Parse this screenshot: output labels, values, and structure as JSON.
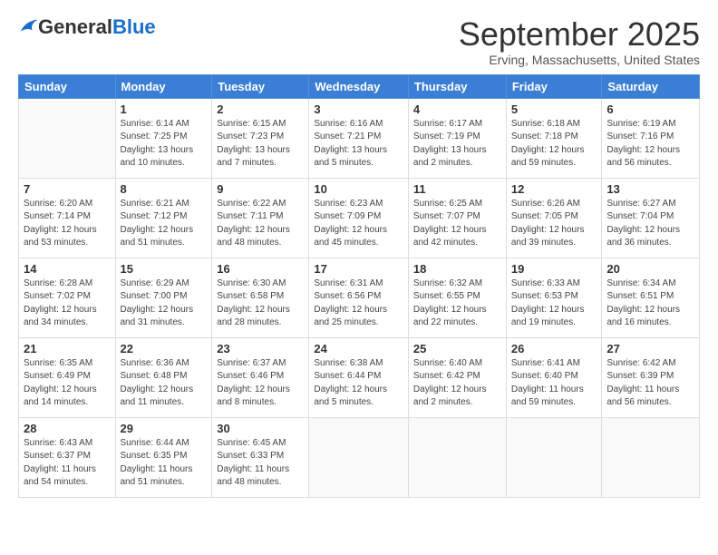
{
  "logo": {
    "general": "General",
    "blue": "Blue"
  },
  "title": "September 2025",
  "location": "Erving, Massachusetts, United States",
  "days_of_week": [
    "Sunday",
    "Monday",
    "Tuesday",
    "Wednesday",
    "Thursday",
    "Friday",
    "Saturday"
  ],
  "weeks": [
    [
      {
        "day": "",
        "info": ""
      },
      {
        "day": "1",
        "info": "Sunrise: 6:14 AM\nSunset: 7:25 PM\nDaylight: 13 hours\nand 10 minutes."
      },
      {
        "day": "2",
        "info": "Sunrise: 6:15 AM\nSunset: 7:23 PM\nDaylight: 13 hours\nand 7 minutes."
      },
      {
        "day": "3",
        "info": "Sunrise: 6:16 AM\nSunset: 7:21 PM\nDaylight: 13 hours\nand 5 minutes."
      },
      {
        "day": "4",
        "info": "Sunrise: 6:17 AM\nSunset: 7:19 PM\nDaylight: 13 hours\nand 2 minutes."
      },
      {
        "day": "5",
        "info": "Sunrise: 6:18 AM\nSunset: 7:18 PM\nDaylight: 12 hours\nand 59 minutes."
      },
      {
        "day": "6",
        "info": "Sunrise: 6:19 AM\nSunset: 7:16 PM\nDaylight: 12 hours\nand 56 minutes."
      }
    ],
    [
      {
        "day": "7",
        "info": "Sunrise: 6:20 AM\nSunset: 7:14 PM\nDaylight: 12 hours\nand 53 minutes."
      },
      {
        "day": "8",
        "info": "Sunrise: 6:21 AM\nSunset: 7:12 PM\nDaylight: 12 hours\nand 51 minutes."
      },
      {
        "day": "9",
        "info": "Sunrise: 6:22 AM\nSunset: 7:11 PM\nDaylight: 12 hours\nand 48 minutes."
      },
      {
        "day": "10",
        "info": "Sunrise: 6:23 AM\nSunset: 7:09 PM\nDaylight: 12 hours\nand 45 minutes."
      },
      {
        "day": "11",
        "info": "Sunrise: 6:25 AM\nSunset: 7:07 PM\nDaylight: 12 hours\nand 42 minutes."
      },
      {
        "day": "12",
        "info": "Sunrise: 6:26 AM\nSunset: 7:05 PM\nDaylight: 12 hours\nand 39 minutes."
      },
      {
        "day": "13",
        "info": "Sunrise: 6:27 AM\nSunset: 7:04 PM\nDaylight: 12 hours\nand 36 minutes."
      }
    ],
    [
      {
        "day": "14",
        "info": "Sunrise: 6:28 AM\nSunset: 7:02 PM\nDaylight: 12 hours\nand 34 minutes."
      },
      {
        "day": "15",
        "info": "Sunrise: 6:29 AM\nSunset: 7:00 PM\nDaylight: 12 hours\nand 31 minutes."
      },
      {
        "day": "16",
        "info": "Sunrise: 6:30 AM\nSunset: 6:58 PM\nDaylight: 12 hours\nand 28 minutes."
      },
      {
        "day": "17",
        "info": "Sunrise: 6:31 AM\nSunset: 6:56 PM\nDaylight: 12 hours\nand 25 minutes."
      },
      {
        "day": "18",
        "info": "Sunrise: 6:32 AM\nSunset: 6:55 PM\nDaylight: 12 hours\nand 22 minutes."
      },
      {
        "day": "19",
        "info": "Sunrise: 6:33 AM\nSunset: 6:53 PM\nDaylight: 12 hours\nand 19 minutes."
      },
      {
        "day": "20",
        "info": "Sunrise: 6:34 AM\nSunset: 6:51 PM\nDaylight: 12 hours\nand 16 minutes."
      }
    ],
    [
      {
        "day": "21",
        "info": "Sunrise: 6:35 AM\nSunset: 6:49 PM\nDaylight: 12 hours\nand 14 minutes."
      },
      {
        "day": "22",
        "info": "Sunrise: 6:36 AM\nSunset: 6:48 PM\nDaylight: 12 hours\nand 11 minutes."
      },
      {
        "day": "23",
        "info": "Sunrise: 6:37 AM\nSunset: 6:46 PM\nDaylight: 12 hours\nand 8 minutes."
      },
      {
        "day": "24",
        "info": "Sunrise: 6:38 AM\nSunset: 6:44 PM\nDaylight: 12 hours\nand 5 minutes."
      },
      {
        "day": "25",
        "info": "Sunrise: 6:40 AM\nSunset: 6:42 PM\nDaylight: 12 hours\nand 2 minutes."
      },
      {
        "day": "26",
        "info": "Sunrise: 6:41 AM\nSunset: 6:40 PM\nDaylight: 11 hours\nand 59 minutes."
      },
      {
        "day": "27",
        "info": "Sunrise: 6:42 AM\nSunset: 6:39 PM\nDaylight: 11 hours\nand 56 minutes."
      }
    ],
    [
      {
        "day": "28",
        "info": "Sunrise: 6:43 AM\nSunset: 6:37 PM\nDaylight: 11 hours\nand 54 minutes."
      },
      {
        "day": "29",
        "info": "Sunrise: 6:44 AM\nSunset: 6:35 PM\nDaylight: 11 hours\nand 51 minutes."
      },
      {
        "day": "30",
        "info": "Sunrise: 6:45 AM\nSunset: 6:33 PM\nDaylight: 11 hours\nand 48 minutes."
      },
      {
        "day": "",
        "info": ""
      },
      {
        "day": "",
        "info": ""
      },
      {
        "day": "",
        "info": ""
      },
      {
        "day": "",
        "info": ""
      }
    ]
  ]
}
